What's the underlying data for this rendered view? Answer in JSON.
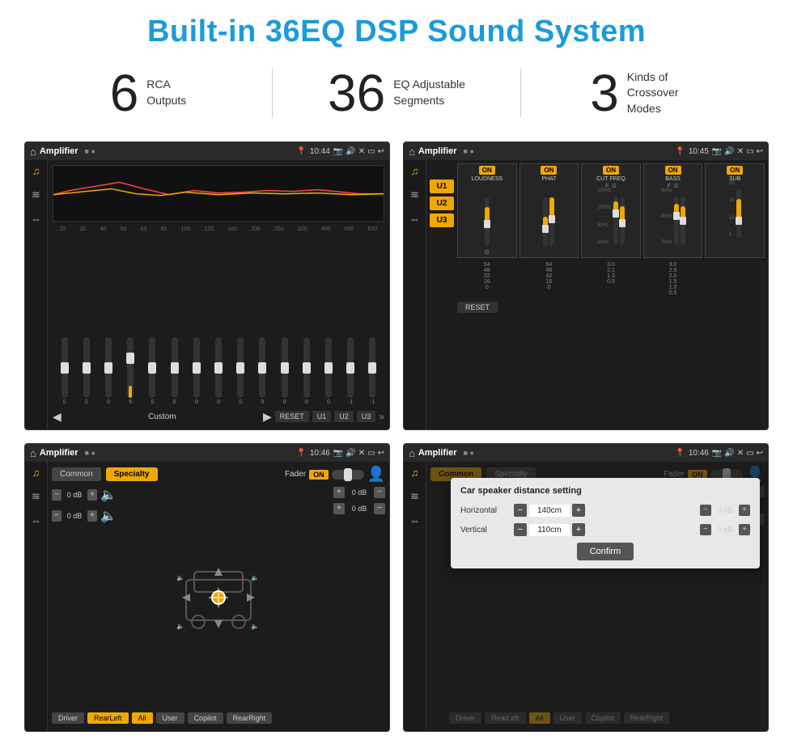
{
  "title": "Built-in 36EQ DSP Sound System",
  "stats": [
    {
      "number": "6",
      "label": "RCA\nOutputs"
    },
    {
      "number": "36",
      "label": "EQ Adjustable\nSegments"
    },
    {
      "number": "3",
      "label": "Kinds of\nCrossover Modes"
    }
  ],
  "screens": {
    "eq": {
      "topbar": {
        "appName": "Amplifier",
        "time": "10:44"
      },
      "frequencies": [
        "25",
        "32",
        "40",
        "50",
        "63",
        "80",
        "100",
        "125",
        "160",
        "200",
        "250",
        "320",
        "400",
        "500",
        "630"
      ],
      "sliderValues": [
        "0",
        "0",
        "0",
        "5",
        "0",
        "0",
        "0",
        "0",
        "0",
        "0",
        "0",
        "0",
        "0",
        "-1",
        "-1"
      ],
      "preset": "Custom",
      "buttons": {
        "reset": "RESET",
        "u1": "U1",
        "u2": "U2",
        "u3": "U3"
      }
    },
    "crossover": {
      "topbar": {
        "appName": "Amplifier",
        "time": "10:45"
      },
      "uButtons": [
        "U1",
        "U2",
        "U3"
      ],
      "channels": [
        {
          "name": "LOUDNESS",
          "on": true
        },
        {
          "name": "PHAT",
          "on": true
        },
        {
          "name": "CUT FREQ",
          "on": true
        },
        {
          "name": "BASS",
          "on": true
        },
        {
          "name": "SUB",
          "on": true
        }
      ],
      "resetBtn": "RESET"
    },
    "fader": {
      "topbar": {
        "appName": "Amplifier",
        "time": "10:46"
      },
      "tabs": [
        "Common",
        "Specialty"
      ],
      "activeTab": "Specialty",
      "faderLabel": "Fader",
      "onBadge": "ON",
      "channels": {
        "topLeft": "0 dB",
        "topRight": "0 dB",
        "bottomLeft": "0 dB",
        "bottomRight": "0 dB"
      },
      "zoneButtons": [
        "Driver",
        "RearLeft",
        "All",
        "User",
        "Copilot",
        "RearRight"
      ]
    },
    "distance": {
      "topbar": {
        "appName": "Amplifier",
        "time": "10:46"
      },
      "tabs": [
        "Common",
        "Specialty"
      ],
      "activeTab": "Common",
      "faderLabel": "Fader",
      "onBadge": "ON",
      "dialog": {
        "title": "Car speaker distance setting",
        "horizontal": {
          "label": "Horizontal",
          "value": "140cm"
        },
        "vertical": {
          "label": "Vertical",
          "value": "110cm"
        },
        "confirmBtn": "Confirm"
      },
      "channels": {
        "topRight": "0 dB",
        "bottomRight": "0 dB"
      },
      "zoneButtons": [
        "Driver",
        "RearLeft",
        "All",
        "User",
        "Copilot",
        "RearRight"
      ]
    }
  },
  "icons": {
    "home": "⌂",
    "back": "↩",
    "location": "📍",
    "camera": "📷",
    "volume": "🔊",
    "eq": "♫",
    "waveform": "≋",
    "balance": "⇔",
    "settings": "⚙",
    "person": "👤",
    "speaker": "🔈"
  }
}
